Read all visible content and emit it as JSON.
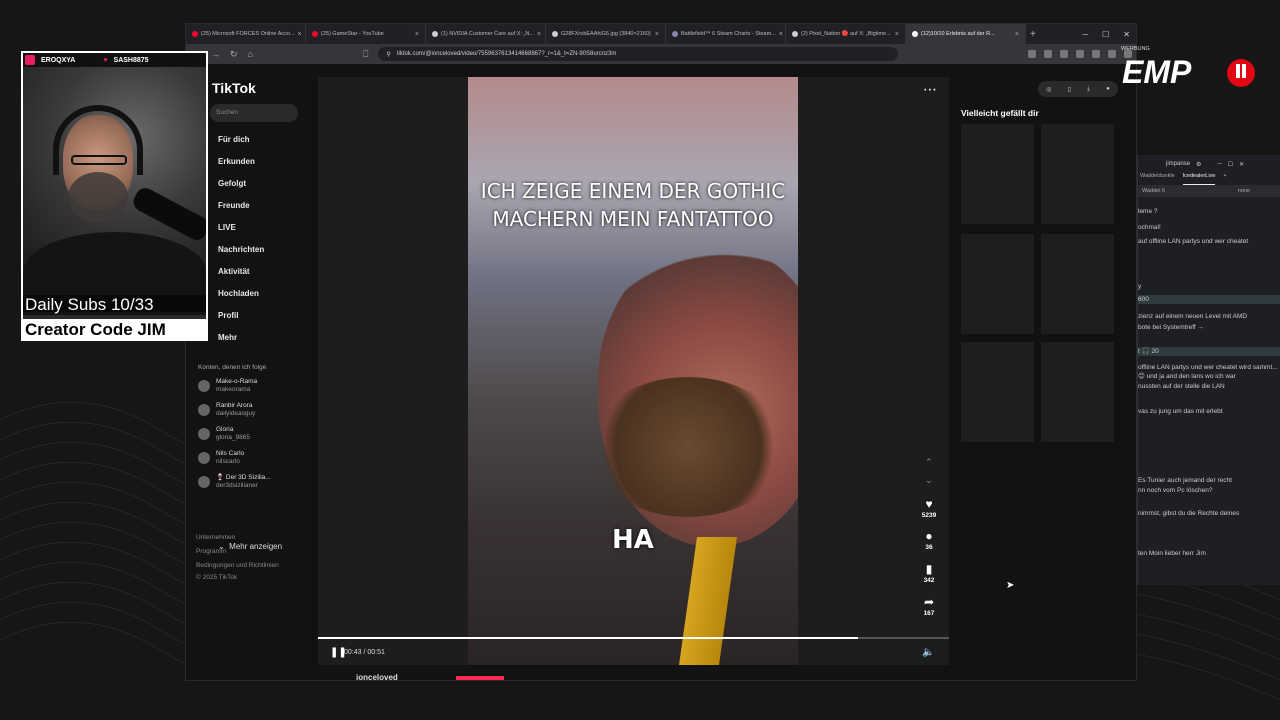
{
  "browser": {
    "tabs": [
      {
        "label": "(25) Microsoft FORCES Online Acco...",
        "color": "#ff0033"
      },
      {
        "label": "(25) GameStar - YouTube",
        "color": "#ff0033"
      },
      {
        "label": "(1) NVIDIA Customer Care auf X: „N...",
        "color": "#cccccc"
      },
      {
        "label": "G28FXrobEAAhiG5.jpg (3840×2160)",
        "color": "#cccccc"
      },
      {
        "label": "Battlefield™ 6 Steam Charts - Steam...",
        "color": "#8888aa"
      },
      {
        "label": "(2) Pixel_Nation 🔴 auf X: „Bigtime...",
        "color": "#cccccc"
      },
      {
        "label": "(12)10/10 Erlebnis auf der R...",
        "color": "#ffffff",
        "active": true
      }
    ],
    "new_tab": "+",
    "url": "tiktok.com/@ionceloved/video/7559637613414668867?_r=1&_t=ZN-90S8urcnz3m"
  },
  "tiktok": {
    "logo": "TikTok",
    "search_placeholder": "Suchen",
    "nav": [
      "Für dich",
      "Erkunden",
      "Gefolgt",
      "Freunde",
      "LIVE",
      "Nachrichten",
      "Aktivität",
      "Hochladen",
      "Profil",
      "Mehr"
    ],
    "following_title": "Konten, denen ich folge",
    "accounts": [
      {
        "name": "Make-o-Rama",
        "handle": "makeorama"
      },
      {
        "name": "Ranbir Arora",
        "handle": "dailyideasguy"
      },
      {
        "name": "Gloria",
        "handle": "gloria_9865"
      },
      {
        "name": "Nils Carlo",
        "handle": "nilscarlo"
      },
      {
        "name": "🍷 Der 3D Sizilia...",
        "handle": "der3dsizilianer"
      }
    ],
    "show_more": "Mehr anzeigen",
    "footer": [
      "Unternehmen",
      "Programm",
      "Bedingungen und Richtlinien",
      "© 2025 TikTok"
    ],
    "video": {
      "caption": "ICH ZEIGE EINEM DER GOTHIC MACHERN MEIN FANTATTOO",
      "overlay_word": "HA",
      "time": "00:43 / 00:51",
      "progress": 0.855,
      "likes": "5239",
      "comments": "36",
      "saves": "342",
      "shares": "167"
    },
    "uploader": "ionceloved",
    "recommend_title": "Vielleicht gefällt dir"
  },
  "chat": {
    "title": "jimpanse",
    "tabs": [
      "Waddeldunkle",
      "IcedealerLive"
    ],
    "sub": "Waddel 6",
    "sub_right": "none",
    "messages": [
      {
        "text": "leme ?",
        "hl": false
      },
      {
        "text": "ochmal!",
        "hl": false
      },
      {
        "text": "auf offline LAN partys und wer cheatet",
        "hl": false
      },
      {
        "text": "y",
        "hl": false
      },
      {
        "text": " 600",
        "hl": true
      },
      {
        "text": "zienz auf einem neuen Level mit AMD",
        "hl": false
      },
      {
        "text": "bote bei Systemtreff →",
        "hl": false
      },
      {
        "text": "t  🎧 20",
        "hl": true
      },
      {
        "text": "offline LAN partys und wer cheatet wird sammt...",
        "hl": false
      },
      {
        "text": "😊 und ja and den lans wo ich war",
        "hl": false
      },
      {
        "text": "nussten auf der stelle die LAN",
        "hl": false
      },
      {
        "text": "vas zu jung um das mit erlebt",
        "hl": false
      },
      {
        "text": "Es Tunier auch jemand der recht",
        "hl": false
      },
      {
        "text": "nn noch vom Pc löschen?",
        "hl": false
      },
      {
        "text": "nimmst, gibst du die Rechte deines",
        "hl": false
      },
      {
        "text": "ten Moin lieber herr Jim",
        "hl": false
      }
    ]
  },
  "stream": {
    "user1": "EROQXYA",
    "user2": "SASH8875",
    "subs": "Daily Subs 10/33",
    "code": "Creator Code JIM",
    "ad_label": "WERBUNG",
    "brand": "EMP",
    "brand_color": "#e30613"
  }
}
